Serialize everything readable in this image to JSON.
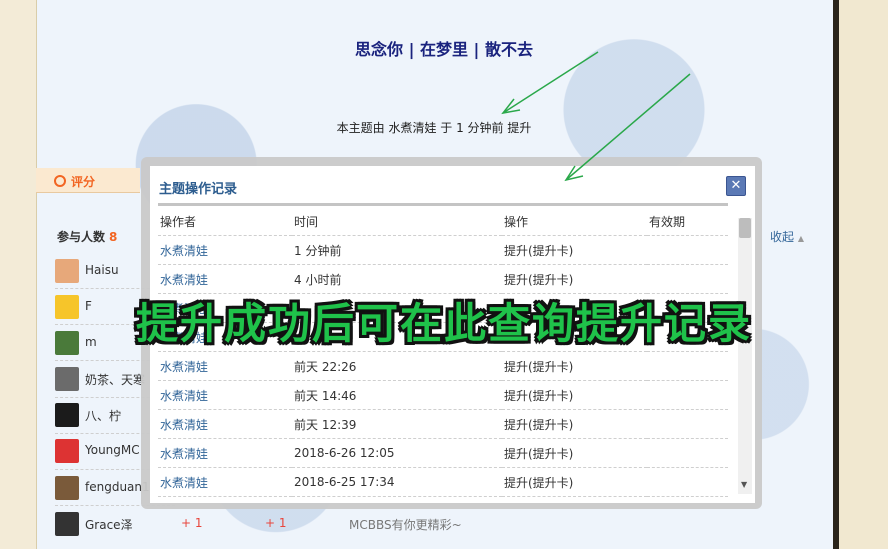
{
  "post": {
    "title": "思念你 | 在梦里 | 散不去",
    "promote_note": "本主题由 水煮清娃 于 1 分钟前 提升"
  },
  "rating": {
    "tab_label": "评分",
    "participants_label": "参与人数",
    "participants_count": "8",
    "collapse_label": "收起"
  },
  "users": [
    {
      "name": "Haisu",
      "color": "#e7a87a"
    },
    {
      "name": "F",
      "color": "#f6c52a"
    },
    {
      "name": "m",
      "color": "#4a7a3a"
    },
    {
      "name": "奶茶、天寒",
      "color": "#6b6b6b"
    },
    {
      "name": "八、柠",
      "color": "#1b1b1b"
    },
    {
      "name": "YoungMC",
      "color": "#d33"
    },
    {
      "name": "fengduan1",
      "color": "#7a5a3a"
    },
    {
      "name": "Grace泽",
      "color": "#333"
    }
  ],
  "bottom_row": {
    "plus1": "+ 1",
    "plus2": "+ 1",
    "tagline": "MCBBS有你更精彩~"
  },
  "dialog": {
    "title": "主题操作记录",
    "close_label": "✕",
    "headers": [
      "操作者",
      "时间",
      "操作",
      "有效期"
    ],
    "rows": [
      {
        "operator": "水煮清娃",
        "time": "1 分钟前",
        "action": "提升(提升卡)",
        "expiry": ""
      },
      {
        "operator": "水煮清娃",
        "time": "4 小时前",
        "action": "提升(提升卡)",
        "expiry": ""
      },
      {
        "operator": "水煮清娃",
        "time": "",
        "action": "",
        "expiry": ""
      },
      {
        "operator": "水煮清娃",
        "time": "",
        "action": "",
        "expiry": ""
      },
      {
        "operator": "水煮清娃",
        "time": "前天 22:26",
        "action": "提升(提升卡)",
        "expiry": ""
      },
      {
        "operator": "水煮清娃",
        "time": "前天 14:46",
        "action": "提升(提升卡)",
        "expiry": ""
      },
      {
        "operator": "水煮清娃",
        "time": "前天 12:39",
        "action": "提升(提升卡)",
        "expiry": ""
      },
      {
        "operator": "水煮清娃",
        "time": "2018-6-26 12:05",
        "action": "提升(提升卡)",
        "expiry": ""
      },
      {
        "operator": "水煮清娃",
        "time": "2018-6-25 17:34",
        "action": "提升(提升卡)",
        "expiry": ""
      }
    ]
  },
  "overlay": {
    "caption": "提升成功后可在此查询提升记录",
    "color": "#1fc24a"
  },
  "icons": {
    "rating": "ring-icon",
    "close": "close-icon",
    "scroll_up": "triangle-up-icon",
    "scroll_down": "triangle-down-icon"
  }
}
